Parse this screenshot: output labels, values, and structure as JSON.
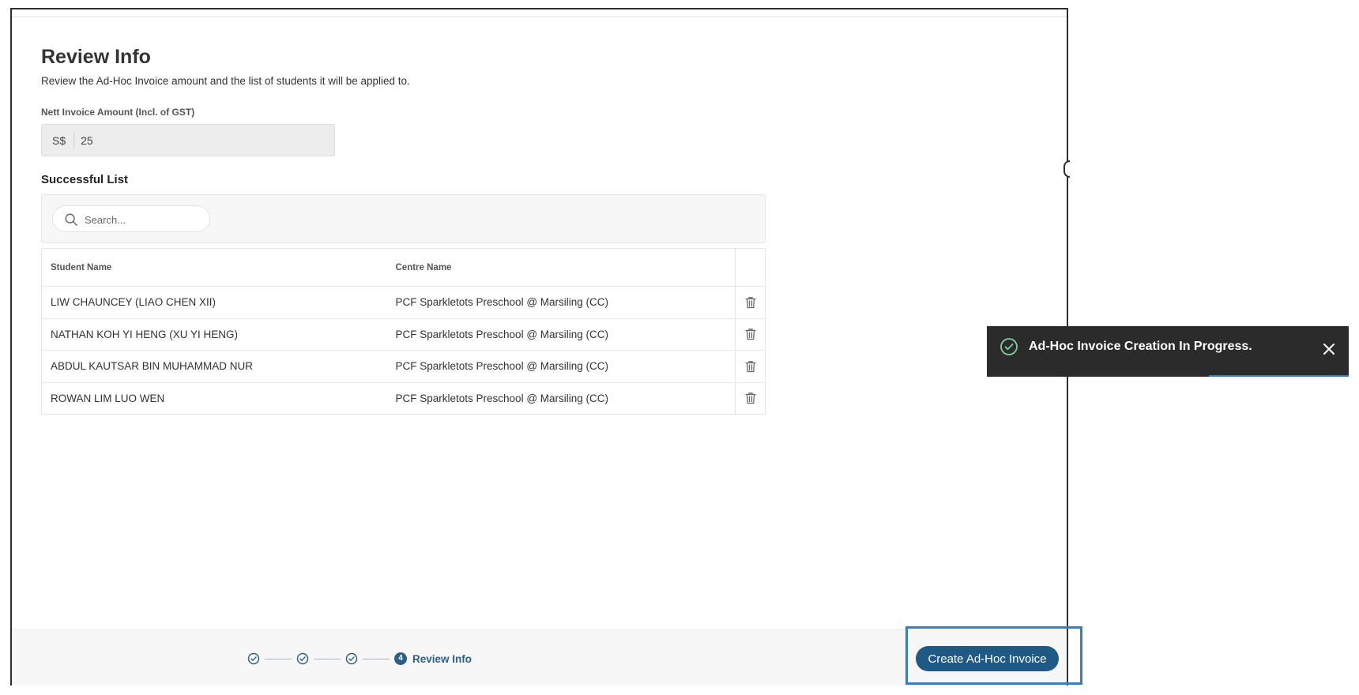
{
  "page": {
    "title": "Review Info",
    "subtitle": "Review the Ad-Hoc Invoice amount and the list of students it will be applied to."
  },
  "amount": {
    "label": "Nett Invoice Amount (Incl. of GST)",
    "prefix": "S$",
    "value": "25"
  },
  "list": {
    "title": "Successful List",
    "search_placeholder": "Search...",
    "columns": [
      "Student Name",
      "Centre Name"
    ],
    "rows": [
      {
        "student": "LIW CHAUNCEY (LIAO CHEN XII)",
        "centre": "PCF Sparkletots Preschool @ Marsiling (CC)"
      },
      {
        "student": "NATHAN KOH YI HENG (XU YI HENG)",
        "centre": "PCF Sparkletots Preschool @ Marsiling (CC)"
      },
      {
        "student": "ABDUL KAUTSAR BIN MUHAMMAD NUR",
        "centre": "PCF Sparkletots Preschool @ Marsiling (CC)"
      },
      {
        "student": "ROWAN LIM LUO WEN",
        "centre": "PCF Sparkletots Preschool @ Marsiling (CC)"
      }
    ]
  },
  "stepper": {
    "current_step_number": "4",
    "current_step_label": "Review Info",
    "completed_icons": [
      "check-circle-icon",
      "check-circle-icon",
      "check-circle-icon"
    ]
  },
  "actions": {
    "create_label": "Create Ad-Hoc Invoice"
  },
  "toast": {
    "message": "Ad-Hoc Invoice Creation In Progress.",
    "icon": "check-circle-icon",
    "close_icon": "close-icon"
  },
  "colors": {
    "primary": "#1f5a86",
    "toast_bg": "#2b2b2b",
    "success": "#7fcf9a",
    "highlight": "#3a7ebb"
  }
}
